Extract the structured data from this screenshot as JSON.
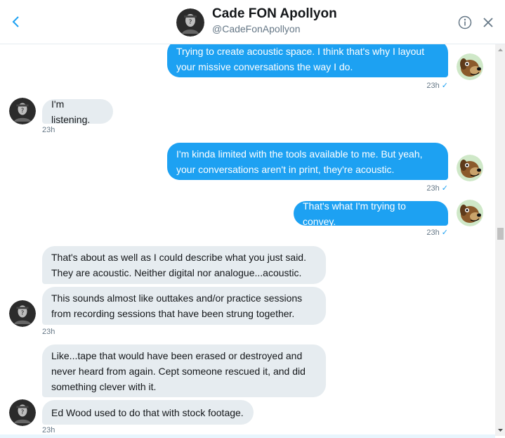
{
  "header": {
    "name": "Cade FON Apollyon",
    "handle": "@CadeFonApollyon"
  },
  "icons": {
    "back": "chevron-left-icon",
    "info": "info-icon",
    "close": "close-icon",
    "read_receipt": "check-icon"
  },
  "colors": {
    "outgoing_bubble": "#1da1f2",
    "incoming_bubble": "#e6ecf0",
    "meta_text": "#657786"
  },
  "messages": [
    {
      "dir": "out",
      "text": "Trying to create acoustic space. I think that's why I layout your missive conversations the way I do.",
      "time": "23h",
      "check": "✓"
    },
    {
      "dir": "in",
      "text": "I'm listening.",
      "time": "23h"
    },
    {
      "dir": "out",
      "text": "I'm kinda limited with the tools available to me. But yeah, your conversations aren't in print, they're acoustic.",
      "time": "23h",
      "check": "✓"
    },
    {
      "dir": "out",
      "text": "That's what I'm trying to convey.",
      "time": "23h",
      "check": "✓"
    },
    {
      "dir": "in",
      "text": "That's about as well as I could describe what you just said. They are acoustic. Neither digital nor analogue...acoustic."
    },
    {
      "dir": "in",
      "text": "This sounds almost like outtakes and/or practice sessions from recording sessions that have been strung together.",
      "time": "23h"
    },
    {
      "dir": "in",
      "text": "Like...tape that would have been erased or destroyed and never heard from again. Cept someone rescued it, and did something clever with it."
    },
    {
      "dir": "in",
      "text": "Ed Wood used to do that with stock footage.",
      "time": "23h"
    }
  ]
}
